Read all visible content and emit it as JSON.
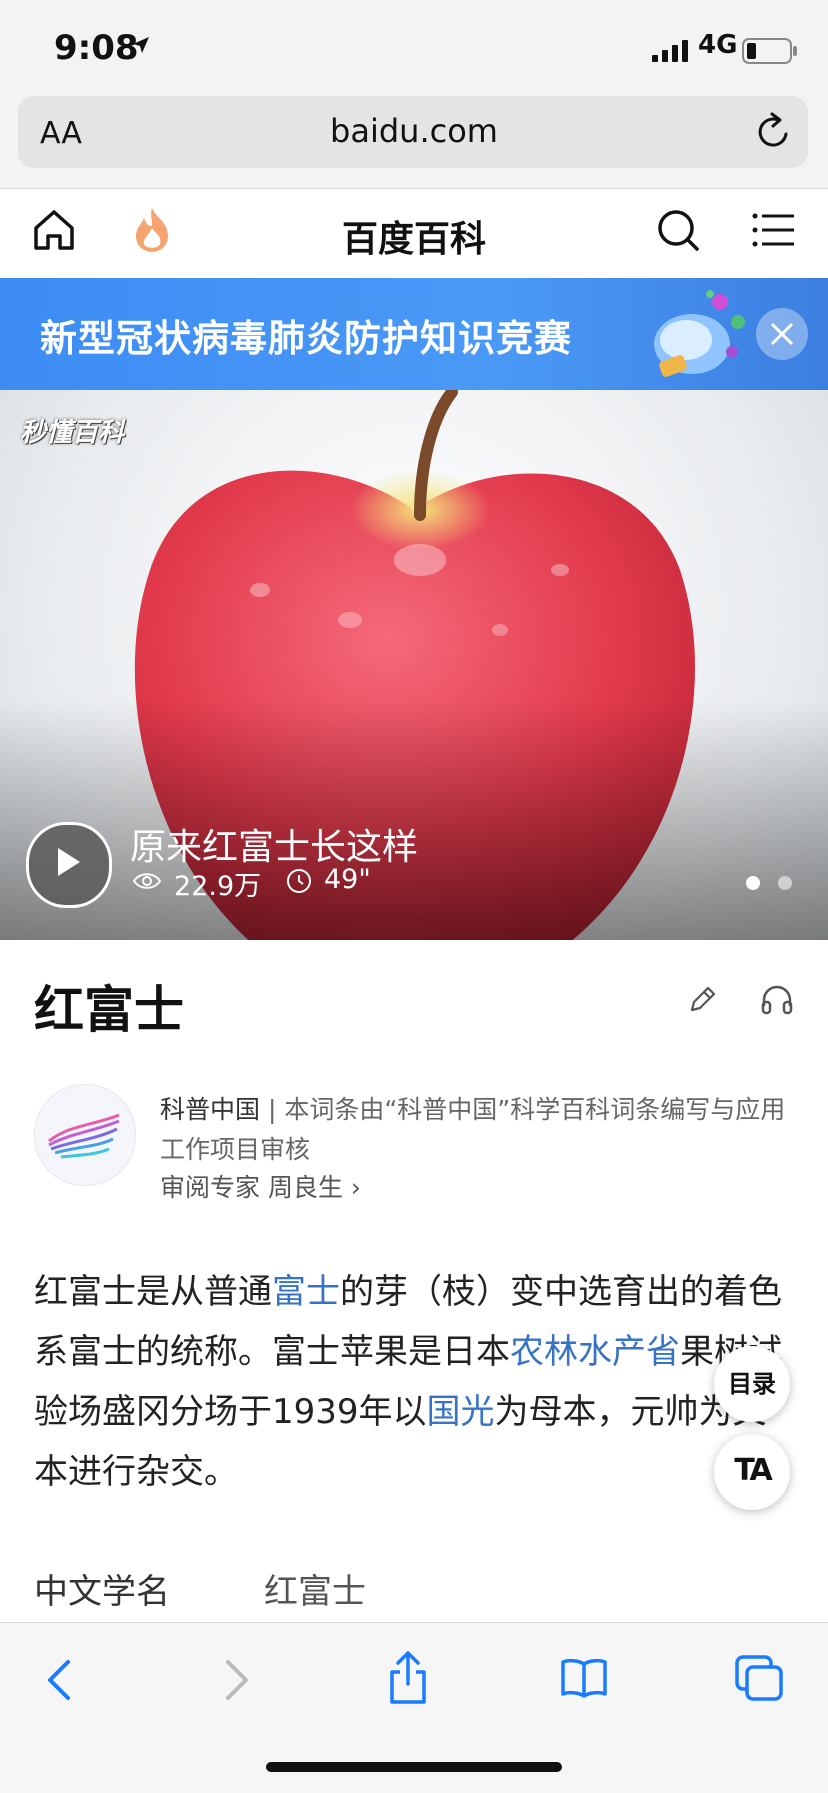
{
  "status": {
    "time": "9:08",
    "network": "4G"
  },
  "browser": {
    "text_size": "AA",
    "url": "baidu.com"
  },
  "nav": {
    "title": "百度百科"
  },
  "banner": {
    "text": "新型冠状病毒肺炎防护知识竞赛"
  },
  "hero": {
    "watermark": "秒懂百科",
    "video_title": "原来红富士长这样",
    "views": "22.9万",
    "duration": "49\""
  },
  "entry": {
    "title": "红富士",
    "org_name": "科普中国",
    "org_desc": "| 本词条由“科普中国”科学百科词条编写与应用工作项目审核",
    "reviewer": "审阅专家 周良生 ›",
    "para": {
      "p1": "红富士是从普通",
      "l1": "富士",
      "p2": "的芽（枝）变中选育出的着色系富士的统称。富士苹果是日本",
      "l2": "农林水产省",
      "p3": "果树试验场盛冈分场于1939年以",
      "l3": "国光",
      "p4": "为母本，元帅为父本进行杂交。"
    },
    "info_label": "中文学名",
    "info_value": "红富士"
  },
  "floating": {
    "toc": "目录",
    "ta": "TA"
  },
  "colors": {
    "link": "#3673c5",
    "banner": "#3d8cf4",
    "ios_blue": "#1a7bff"
  }
}
